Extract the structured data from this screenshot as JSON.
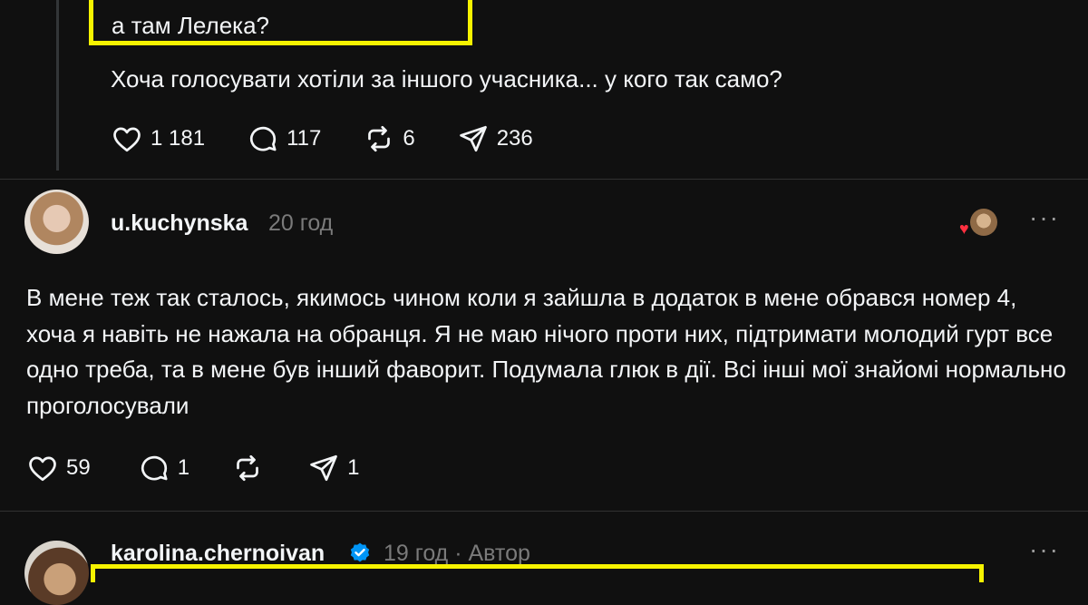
{
  "post1": {
    "quote": "а там Лелека?",
    "text": "Хоча голосувати хотіли за іншого учасника... у кого так само?",
    "likes": "1 181",
    "replies": "117",
    "reposts": "6",
    "shares": "236"
  },
  "comment1": {
    "username": "u.kuchynska",
    "time": "20 год",
    "text": "В мене теж так сталось, якимось чином коли я зайшла в додаток в мене обрався номер 4, хоча я навіть не нажала на обранця. Я не маю нічого проти них, підтримати молодий гурт все одно треба, та в мене був інший фаворит. Подумала глюк в дії. Всі інші мої знайомі нормально проголосували",
    "likes": "59",
    "replies": "1",
    "shares": "1",
    "more": "···"
  },
  "comment2": {
    "username": "karolina.chernoivan",
    "time": "19 год",
    "separator": "·",
    "author_label": "Автор",
    "more": "···"
  },
  "colors": {
    "background": "#101010",
    "highlight": "#f6f300",
    "verified": "#0095f6",
    "like_heart": "#ff3040"
  }
}
